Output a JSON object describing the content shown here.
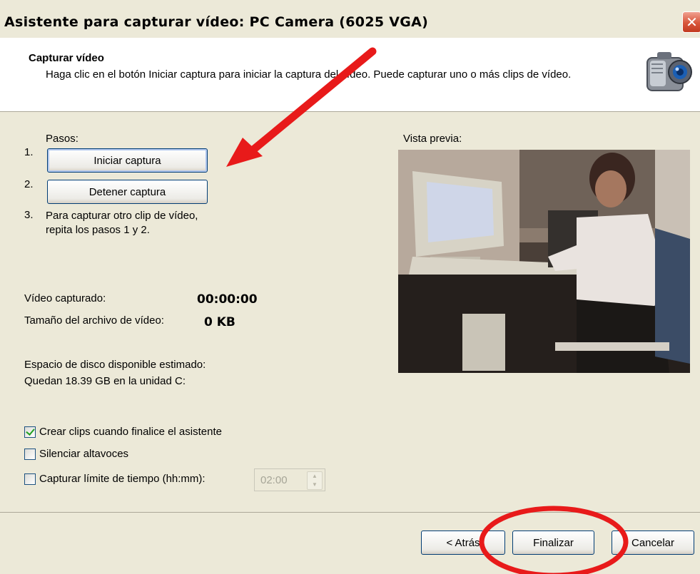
{
  "window": {
    "title": "Asistente para capturar vídeo: PC Camera (6025 VGA)",
    "close_label": "✕"
  },
  "header": {
    "title": "Capturar vídeo",
    "description": "Haga clic en el botón Iniciar captura para iniciar la captura del vídeo. Puede capturar uno o más clips de vídeo.",
    "icon": "camcorder-icon"
  },
  "steps": {
    "label": "Pasos:",
    "step1_num": "1.",
    "step1_button": "Iniciar captura",
    "step2_num": "2.",
    "step2_button": "Detener captura",
    "step3_num": "3.",
    "step3_text": "Para capturar otro clip de vídeo, repita los pasos 1 y 2."
  },
  "capture": {
    "video_label": "Vídeo capturado:",
    "video_value": "00:00:00",
    "size_label": "Tamaño del archivo de vídeo:",
    "size_value": "0 KB",
    "disk_label": "Espacio de disco disponible estimado:",
    "disk_value": "Quedan 18.39 GB en la unidad C:"
  },
  "preview": {
    "label": "Vista previa:"
  },
  "options": {
    "create_clips": {
      "label": "Crear clips cuando finalice el asistente",
      "checked": true
    },
    "mute_speakers": {
      "label": "Silenciar altavoces",
      "checked": false
    },
    "time_limit": {
      "label": "Capturar límite de tiempo (hh:mm):",
      "checked": false,
      "value": "02:00"
    }
  },
  "footer": {
    "back": "< Atrás",
    "finish": "Finalizar",
    "cancel": "Cancelar"
  },
  "colors": {
    "arrow": "#e81a1a",
    "title_close": "#d8553a",
    "dialog_bg": "#ece9d8"
  }
}
